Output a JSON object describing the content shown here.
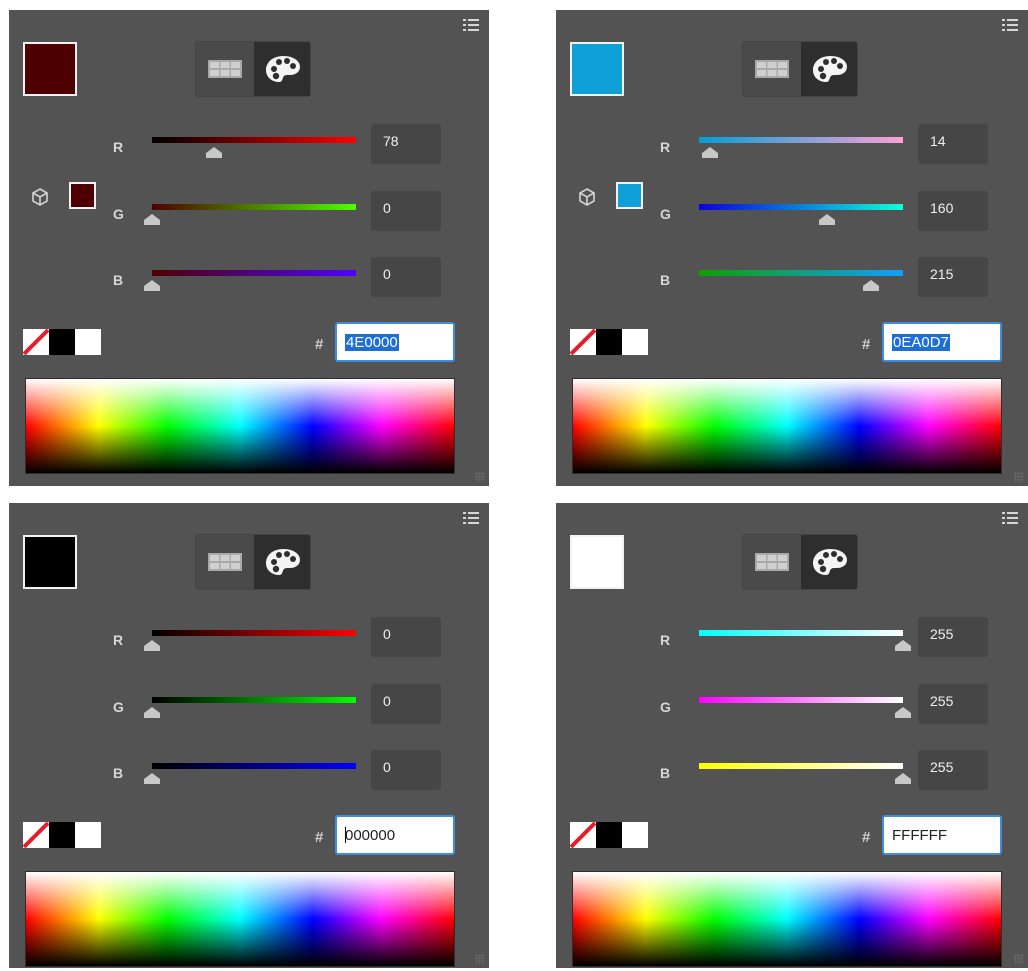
{
  "panels": [
    {
      "color": "#4E0000",
      "hex": "4E0000",
      "hex_state": "selected",
      "channels": [
        {
          "label": "R",
          "value": "78",
          "fraction": 0.306,
          "grad": "linear-gradient(to right,#000000,#ff0000)"
        },
        {
          "label": "G",
          "value": "0",
          "fraction": 0.0,
          "grad": "linear-gradient(to right,#4e0000,#4eff00)"
        },
        {
          "label": "B",
          "value": "0",
          "fraction": 0.0,
          "grad": "linear-gradient(to right,#4e0000,#4e00ff)"
        }
      ],
      "show_cube": true
    },
    {
      "color": "#0EA0D7",
      "hex": "0EA0D7",
      "hex_state": "selected",
      "channels": [
        {
          "label": "R",
          "value": "14",
          "fraction": 0.055,
          "grad": "linear-gradient(to right,#00a0d7,#ffa0d7)"
        },
        {
          "label": "G",
          "value": "160",
          "fraction": 0.627,
          "grad": "linear-gradient(to right,#0e00d7,#0effd7)"
        },
        {
          "label": "B",
          "value": "215",
          "fraction": 0.843,
          "grad": "linear-gradient(to right,#0ea000,#0ea0ff)"
        }
      ],
      "show_cube": true
    },
    {
      "color": "#000000",
      "hex": "000000",
      "hex_state": "caret",
      "channels": [
        {
          "label": "R",
          "value": "0",
          "fraction": 0.0,
          "grad": "linear-gradient(to right,#000000,#ff0000)"
        },
        {
          "label": "G",
          "value": "0",
          "fraction": 0.0,
          "grad": "linear-gradient(to right,#000000,#00ff00)"
        },
        {
          "label": "B",
          "value": "0",
          "fraction": 0.0,
          "grad": "linear-gradient(to right,#000000,#0000ff)"
        }
      ],
      "show_cube": false
    },
    {
      "color": "#FFFFFF",
      "hex": "FFFFFF",
      "hex_state": "plain",
      "channels": [
        {
          "label": "R",
          "value": "255",
          "fraction": 1.0,
          "grad": "linear-gradient(to right,#00ffff,#ffffff)"
        },
        {
          "label": "G",
          "value": "255",
          "fraction": 1.0,
          "grad": "linear-gradient(to right,#ff00ff,#ffffff)"
        },
        {
          "label": "B",
          "value": "255",
          "fraction": 1.0,
          "grad": "linear-gradient(to right,#ffff00,#ffffff)"
        }
      ],
      "show_cube": false
    }
  ],
  "labels": {
    "hash": "#"
  },
  "icons": {
    "menu": "panel-menu-icon",
    "grid_mode": "swatch-grid-icon",
    "palette_mode": "palette-icon",
    "cube": "out-of-gamut-cube-icon",
    "none_chip": "no-color-icon"
  }
}
